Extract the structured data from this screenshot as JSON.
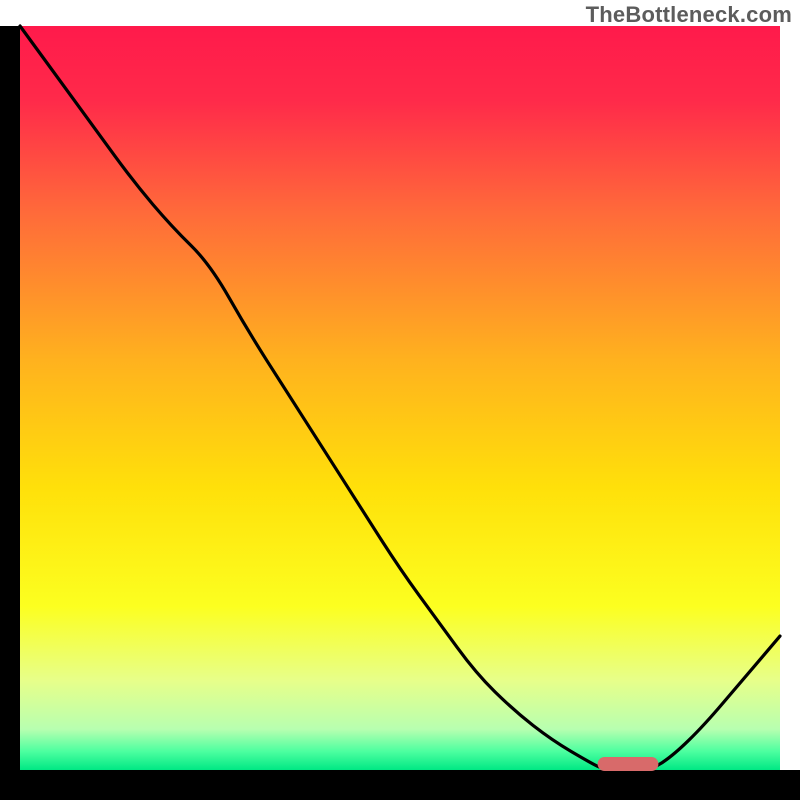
{
  "watermark": "TheBottleneck.com",
  "chart_data": {
    "type": "line",
    "title": "",
    "xlabel": "",
    "ylabel": "",
    "xlim": [
      0,
      100
    ],
    "ylim": [
      0,
      100
    ],
    "background_gradient_stops": [
      {
        "offset": 0.0,
        "color": "#ff1a4b"
      },
      {
        "offset": 0.1,
        "color": "#ff2a4a"
      },
      {
        "offset": 0.25,
        "color": "#ff6a3a"
      },
      {
        "offset": 0.45,
        "color": "#ffb21e"
      },
      {
        "offset": 0.62,
        "color": "#ffe00a"
      },
      {
        "offset": 0.78,
        "color": "#fcff20"
      },
      {
        "offset": 0.88,
        "color": "#e7ff8a"
      },
      {
        "offset": 0.945,
        "color": "#b8ffb0"
      },
      {
        "offset": 0.975,
        "color": "#4dffa0"
      },
      {
        "offset": 1.0,
        "color": "#00e884"
      }
    ],
    "series": [
      {
        "name": "bottleneck-curve",
        "x": [
          0,
          5,
          10,
          15,
          20,
          25,
          30,
          35,
          40,
          45,
          50,
          55,
          60,
          65,
          70,
          75,
          77,
          80,
          83,
          86,
          90,
          95,
          100
        ],
        "y": [
          100,
          93,
          86,
          79,
          73,
          68,
          59,
          51,
          43,
          35,
          27,
          20,
          13,
          8,
          4,
          1,
          0,
          0,
          0,
          2,
          6,
          12,
          18
        ]
      }
    ],
    "marker": {
      "name": "optimal-band",
      "x_center": 80,
      "x_half_width": 4,
      "color": "#d86a6a"
    }
  }
}
